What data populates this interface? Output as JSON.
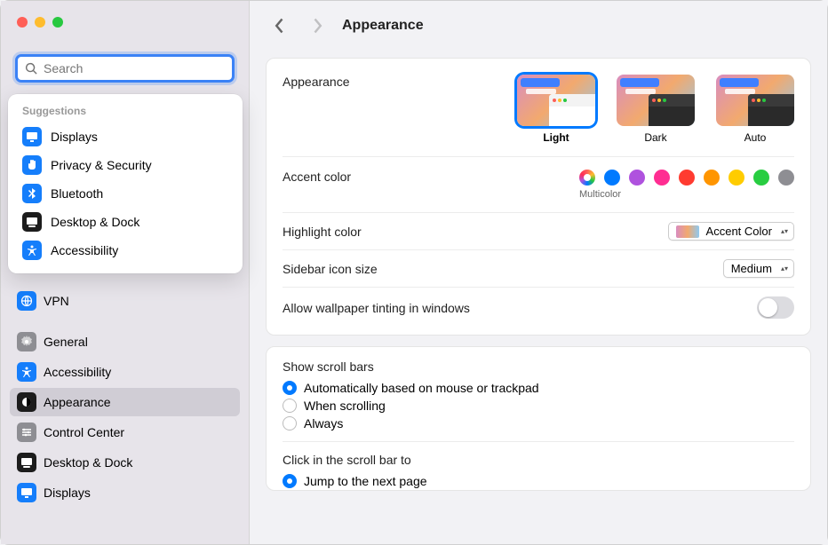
{
  "window": {
    "title": "Appearance"
  },
  "search": {
    "placeholder": "Search",
    "suggestions_title": "Suggestions",
    "suggestions": [
      {
        "label": "Displays",
        "icon": "display",
        "color": "#157efb"
      },
      {
        "label": "Privacy & Security",
        "icon": "hand",
        "color": "#157efb"
      },
      {
        "label": "Bluetooth",
        "icon": "bluetooth",
        "color": "#157efb"
      },
      {
        "label": "Desktop & Dock",
        "icon": "desk",
        "color": "#1c1c1c"
      },
      {
        "label": "Accessibility",
        "icon": "accessibility",
        "color": "#157efb"
      }
    ]
  },
  "sidebar": {
    "upper": [
      {
        "label": "VPN",
        "icon": "globe",
        "color": "#157efb"
      }
    ],
    "lower": [
      {
        "label": "General",
        "icon": "gear",
        "color": "#8e8e93"
      },
      {
        "label": "Accessibility",
        "icon": "accessibility",
        "color": "#157efb"
      },
      {
        "label": "Appearance",
        "icon": "appearance",
        "color": "#1c1c1c",
        "selected": true
      },
      {
        "label": "Control Center",
        "icon": "sliders",
        "color": "#8e8e93"
      },
      {
        "label": "Desktop & Dock",
        "icon": "desk",
        "color": "#1c1c1c"
      },
      {
        "label": "Displays",
        "icon": "display",
        "color": "#157efb"
      }
    ]
  },
  "panel": {
    "appearance_label": "Appearance",
    "modes": [
      {
        "label": "Light",
        "selected": true,
        "dark": false
      },
      {
        "label": "Dark",
        "selected": false,
        "dark": true
      },
      {
        "label": "Auto",
        "selected": false,
        "dark": true
      }
    ],
    "accent_label": "Accent color",
    "accent_selected_label": "Multicolor",
    "accent_colors": [
      "multi",
      "blue",
      "purple",
      "pink",
      "red",
      "orange",
      "yellow",
      "green",
      "gray"
    ],
    "highlight_label": "Highlight color",
    "highlight_value": "Accent Color",
    "sidebar_icon_label": "Sidebar icon size",
    "sidebar_icon_value": "Medium",
    "wallpaper_tint_label": "Allow wallpaper tinting in windows"
  },
  "panel2": {
    "scrollbars_title": "Show scroll bars",
    "scrollbars_options": [
      {
        "label": "Automatically based on mouse or trackpad",
        "checked": true
      },
      {
        "label": "When scrolling",
        "checked": false
      },
      {
        "label": "Always",
        "checked": false
      }
    ],
    "click_title": "Click in the scroll bar to",
    "click_options": [
      {
        "label": "Jump to the next page",
        "checked": true
      }
    ]
  }
}
